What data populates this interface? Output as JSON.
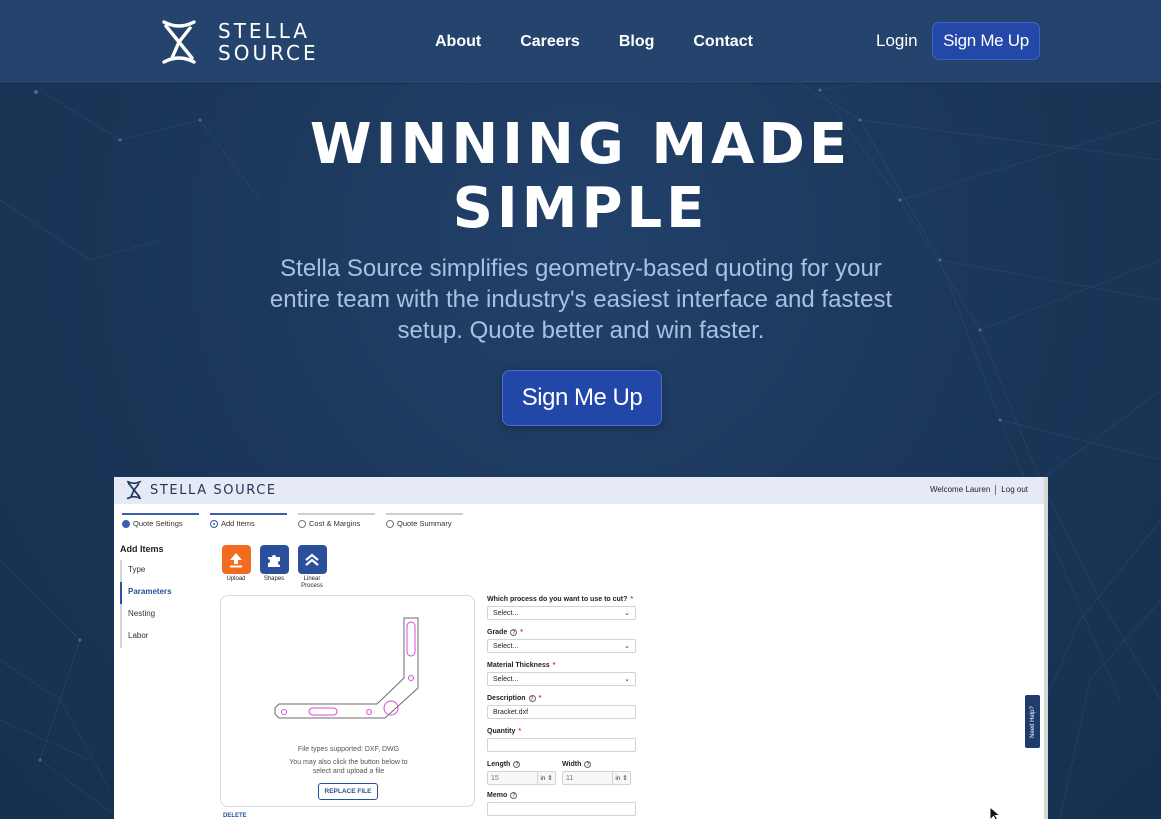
{
  "brand": {
    "name_line1": "STELLA",
    "name_line2": "SOURCE"
  },
  "nav": {
    "links": [
      "About",
      "Careers",
      "Blog",
      "Contact"
    ],
    "login": "Login",
    "signup": "Sign Me Up"
  },
  "hero": {
    "title_line1": "WINNING MADE",
    "title_line2": "SIMPLE",
    "subtitle": "Stella Source simplifies geometry-based quoting for your entire team with the industry's easiest interface and fastest setup. Quote better and win faster.",
    "cta": "Sign Me Up"
  },
  "app": {
    "logo_text": "STELLA SOURCE",
    "welcome": "Welcome Lauren",
    "logout": "Log out",
    "steps": [
      {
        "label": "Quote Settings",
        "state": "done"
      },
      {
        "label": "Add Items",
        "state": "active"
      },
      {
        "label": "Cost & Margins",
        "state": "todo"
      },
      {
        "label": "Quote Summary",
        "state": "todo"
      }
    ],
    "sidebar": {
      "title": "Add Items",
      "items": [
        "Type",
        "Parameters",
        "Nesting",
        "Labor"
      ],
      "active_index": 1
    },
    "tools": [
      {
        "label": "Upload",
        "icon": "upload-icon",
        "color": "#f26b21"
      },
      {
        "label": "Shapes",
        "icon": "puzzle-icon",
        "color": "#2b4f9a"
      },
      {
        "label": "Linear Process",
        "icon": "chevrons-up-icon",
        "color": "#2b4f9a"
      }
    ],
    "upload": {
      "file_types": "File types supported: DXF, DWG",
      "hint": "You may also click the button below to select and upload a file",
      "replace_button": "REPLACE FILE",
      "delete": "DELETE"
    },
    "form": {
      "process": {
        "label": "Which process do you want to use to cut?",
        "value": "Select..."
      },
      "grade": {
        "label": "Grade",
        "value": "Select..."
      },
      "thickness": {
        "label": "Material Thickness",
        "value": "Select..."
      },
      "description": {
        "label": "Description",
        "value": "Bracket.dxf"
      },
      "quantity": {
        "label": "Quantity",
        "value": ""
      },
      "length": {
        "label": "Length",
        "value": "15",
        "unit": "in"
      },
      "width": {
        "label": "Width",
        "value": "11",
        "unit": "in"
      },
      "memo": {
        "label": "Memo",
        "value": ""
      }
    },
    "need_help": "Need Help?"
  },
  "colors": {
    "nav_bg": "#24446e",
    "page_bg": "#1b3558",
    "cta": "#2247a8",
    "subtitle": "#a6c1e2",
    "upload_orange": "#f26b21",
    "accent_blue": "#2c4f9a"
  }
}
